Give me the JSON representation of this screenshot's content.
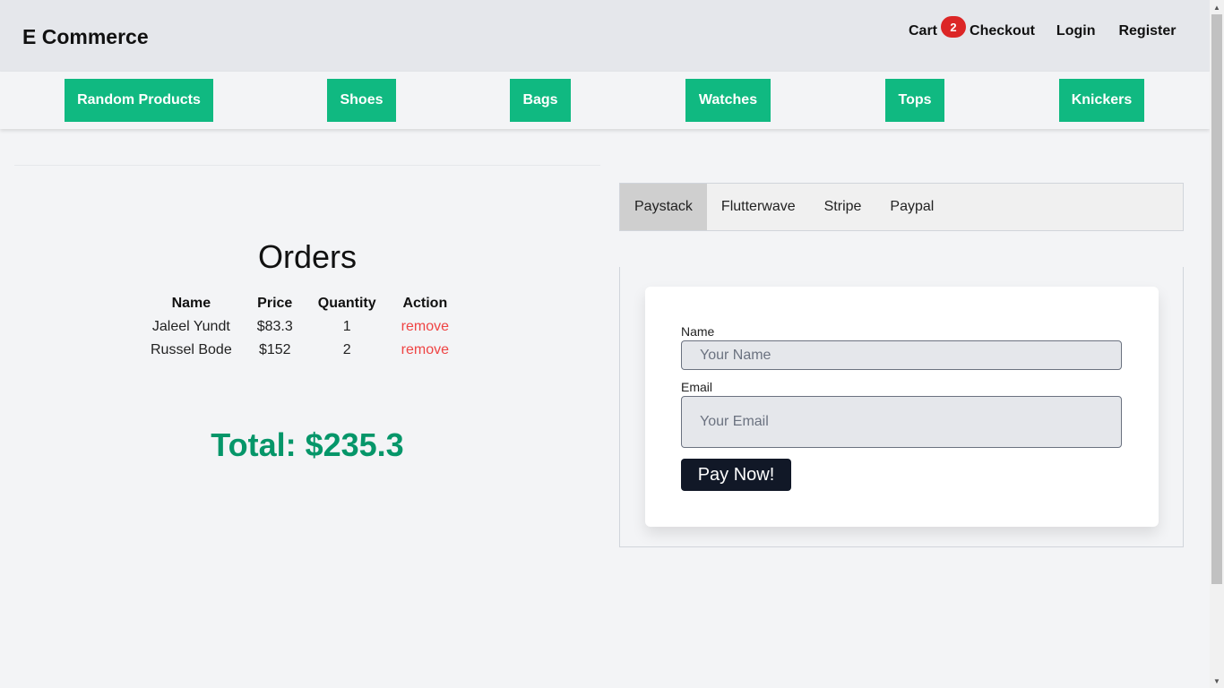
{
  "header": {
    "brand": "E Commerce",
    "nav": {
      "cart": "Cart",
      "cart_count": "2",
      "checkout": "Checkout",
      "login": "Login",
      "register": "Register"
    }
  },
  "categories": [
    "Random Products",
    "Shoes",
    "Bags",
    "Watches",
    "Tops",
    "Knickers"
  ],
  "orders": {
    "title": "Orders",
    "columns": [
      "Name",
      "Price",
      "Quantity",
      "Action"
    ],
    "rows": [
      {
        "name": "Jaleel Yundt",
        "price": "$83.3",
        "quantity": "1",
        "action": "remove"
      },
      {
        "name": "Russel Bode",
        "price": "$152",
        "quantity": "2",
        "action": "remove"
      }
    ],
    "total": "Total: $235.3"
  },
  "payment": {
    "tabs": [
      "Paystack",
      "Flutterwave",
      "Stripe",
      "Paypal"
    ],
    "active_tab": "Paystack",
    "form": {
      "name_label": "Name",
      "name_placeholder": "Your Name",
      "name_value": "",
      "email_label": "Email",
      "email_placeholder": "Your Email",
      "email_value": "",
      "submit_label": "Pay Now!"
    }
  },
  "colors": {
    "accent_green": "#10b981",
    "total_green": "#059669",
    "badge_red": "#dc2626",
    "remove_red": "#ef4444",
    "pay_button": "#111827"
  }
}
